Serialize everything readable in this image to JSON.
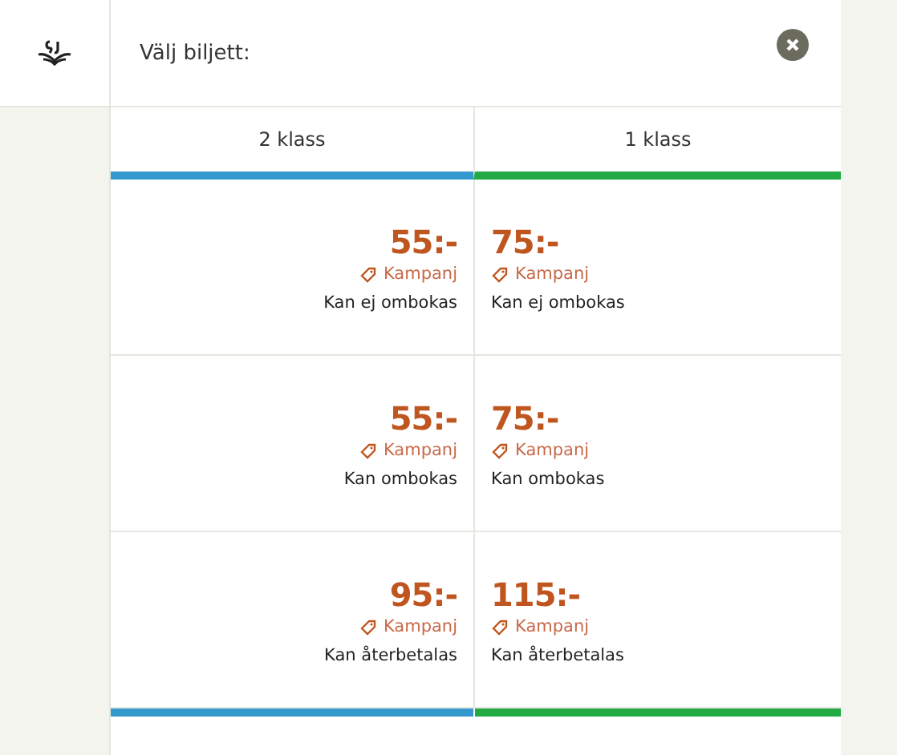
{
  "header": {
    "title": "Välj biljett:"
  },
  "columns": [
    {
      "label": "2 klass",
      "color": "#3399cc"
    },
    {
      "label": "1 klass",
      "color": "#22aa44"
    }
  ],
  "rows": [
    {
      "cells": [
        {
          "price": "55:-",
          "tag": "Kampanj",
          "condition": "Kan ej ombokas"
        },
        {
          "price": "75:-",
          "tag": "Kampanj",
          "condition": "Kan ej ombokas"
        }
      ]
    },
    {
      "cells": [
        {
          "price": "55:-",
          "tag": "Kampanj",
          "condition": "Kan ombokas"
        },
        {
          "price": "75:-",
          "tag": "Kampanj",
          "condition": "Kan ombokas"
        }
      ]
    },
    {
      "cells": [
        {
          "price": "95:-",
          "tag": "Kampanj",
          "condition": "Kan återbetalas"
        },
        {
          "price": "115:-",
          "tag": "Kampanj",
          "condition": "Kan återbetalas"
        }
      ]
    }
  ]
}
